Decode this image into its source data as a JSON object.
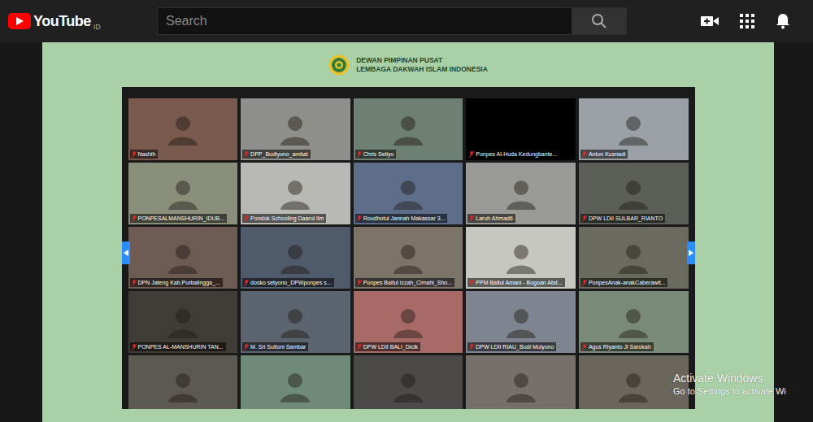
{
  "app": {
    "logo": "YouTube",
    "region": "ID"
  },
  "search": {
    "placeholder": "Search"
  },
  "video": {
    "header": {
      "line1": "DEWAN PIMPINAN PUSAT",
      "line2": "LEMBAGA DAKWAH ISLAM INDONESIA"
    },
    "participants": [
      {
        "name": "Nashih",
        "video": true
      },
      {
        "name": "DPP_Budiyono_ambal",
        "video": true
      },
      {
        "name": "Chris Setiyo",
        "video": true
      },
      {
        "name": "Ponpes Al-Huda Kedungbante...",
        "video": false
      },
      {
        "name": "Anton Kusnadi",
        "video": true
      },
      {
        "name": "PONPESALMANSHURIN_IDUB...",
        "video": true
      },
      {
        "name": "Pondok Schooling Daarul Ilm",
        "video": true
      },
      {
        "name": "Roudhotul Jannah Makassar 3...",
        "video": true
      },
      {
        "name": "Laruh Ahmad6",
        "video": true
      },
      {
        "name": "DPW LDII SULBAR_RIANTO",
        "video": true
      },
      {
        "name": "DPN Jateng Kab.Purbalingga_...",
        "video": true
      },
      {
        "name": "dosko setyono_DPWponpes s...",
        "video": true
      },
      {
        "name": "Ponpes Baitul izzah_Cimahi_Sho...",
        "video": true
      },
      {
        "name": "PPM Baitul Amani - Bogoan Abd...",
        "video": true
      },
      {
        "name": "PonpesAnak-anakCaberawit...",
        "video": true
      },
      {
        "name": "PONPES AL-MANSHURIN TAN...",
        "video": true
      },
      {
        "name": "M. Sri Sultoni Sambar",
        "video": true
      },
      {
        "name": "DPW LDII BALI_Dicik",
        "video": true
      },
      {
        "name": "DPW LDII RIAU_Budi Mulyono",
        "video": true
      },
      {
        "name": "Agus Riyanto Jl Sarokah",
        "video": true
      },
      {
        "video": true
      },
      {
        "video": true
      },
      {
        "video": true
      },
      {
        "video": true
      },
      {
        "video": true
      }
    ],
    "watermark": {
      "line1": "Activate Windows",
      "line2": "Go to Settings to activate Wi"
    }
  }
}
